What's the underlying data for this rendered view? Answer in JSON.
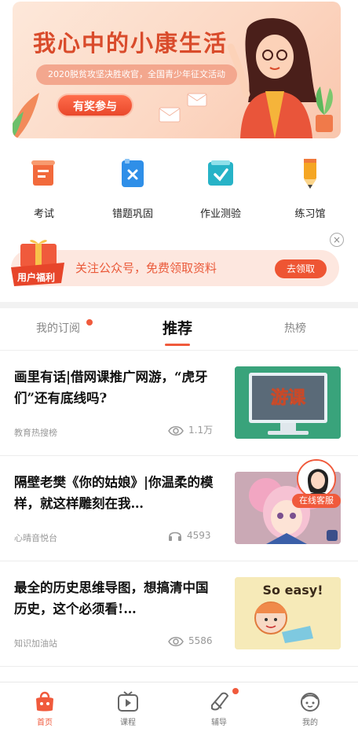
{
  "banner": {
    "title": "我心中的小康生活",
    "subtitle": "2020脱贫攻坚决胜收官，全国青少年征文活动",
    "button_label": "有奖参与"
  },
  "quick_menu": [
    {
      "label": "考试",
      "icon": "exam-scroll-icon",
      "color": "#f26a3c"
    },
    {
      "label": "错题巩固",
      "icon": "wrong-questions-icon",
      "color": "#2f8fe8"
    },
    {
      "label": "作业测验",
      "icon": "homework-check-icon",
      "color": "#27b3c7"
    },
    {
      "label": "练习馆",
      "icon": "pencil-icon",
      "color": "#f5a623"
    }
  ],
  "promo": {
    "badge_text": "用户福利",
    "text": "关注公众号，免费领取资料",
    "button_label": "去领取",
    "close_glyph": "×"
  },
  "tabs": [
    {
      "label": "我的订阅",
      "has_dot": true,
      "active": false
    },
    {
      "label": "推荐",
      "has_dot": false,
      "active": true
    },
    {
      "label": "热榜",
      "has_dot": false,
      "active": false
    }
  ],
  "articles": [
    {
      "title": "画里有话|借网课推广网游，“虎牙们”还有底线吗?",
      "source": "教育热搜榜",
      "stat_icon": "eye-icon",
      "stat": "1.1万",
      "thumb_text": "游课"
    },
    {
      "title": "隔壁老樊《你的姑娘》|你温柔的模样，就这样雕刻在我…",
      "source": "心晴音悦台",
      "stat_icon": "headphones-icon",
      "stat": "4593",
      "thumb_text": ""
    },
    {
      "title": "最全的历史思维导图，想搞清中国历史，这个必须看!…",
      "source": "知识加油站",
      "stat_icon": "eye-icon",
      "stat": "5586",
      "thumb_text": "So easy!"
    }
  ],
  "customer_service": {
    "label": "在线客服"
  },
  "bottom_nav": [
    {
      "label": "首页",
      "icon": "home-bag-icon",
      "active": true,
      "has_dot": false
    },
    {
      "label": "课程",
      "icon": "course-play-icon",
      "active": false,
      "has_dot": false
    },
    {
      "label": "辅导",
      "icon": "tutoring-eraser-icon",
      "active": false,
      "has_dot": true
    },
    {
      "label": "我的",
      "icon": "profile-face-icon",
      "active": false,
      "has_dot": false
    }
  ],
  "colors": {
    "accent": "#f05a3c",
    "banner_title": "#d94b2b",
    "promo_bg": "#fde7df"
  }
}
